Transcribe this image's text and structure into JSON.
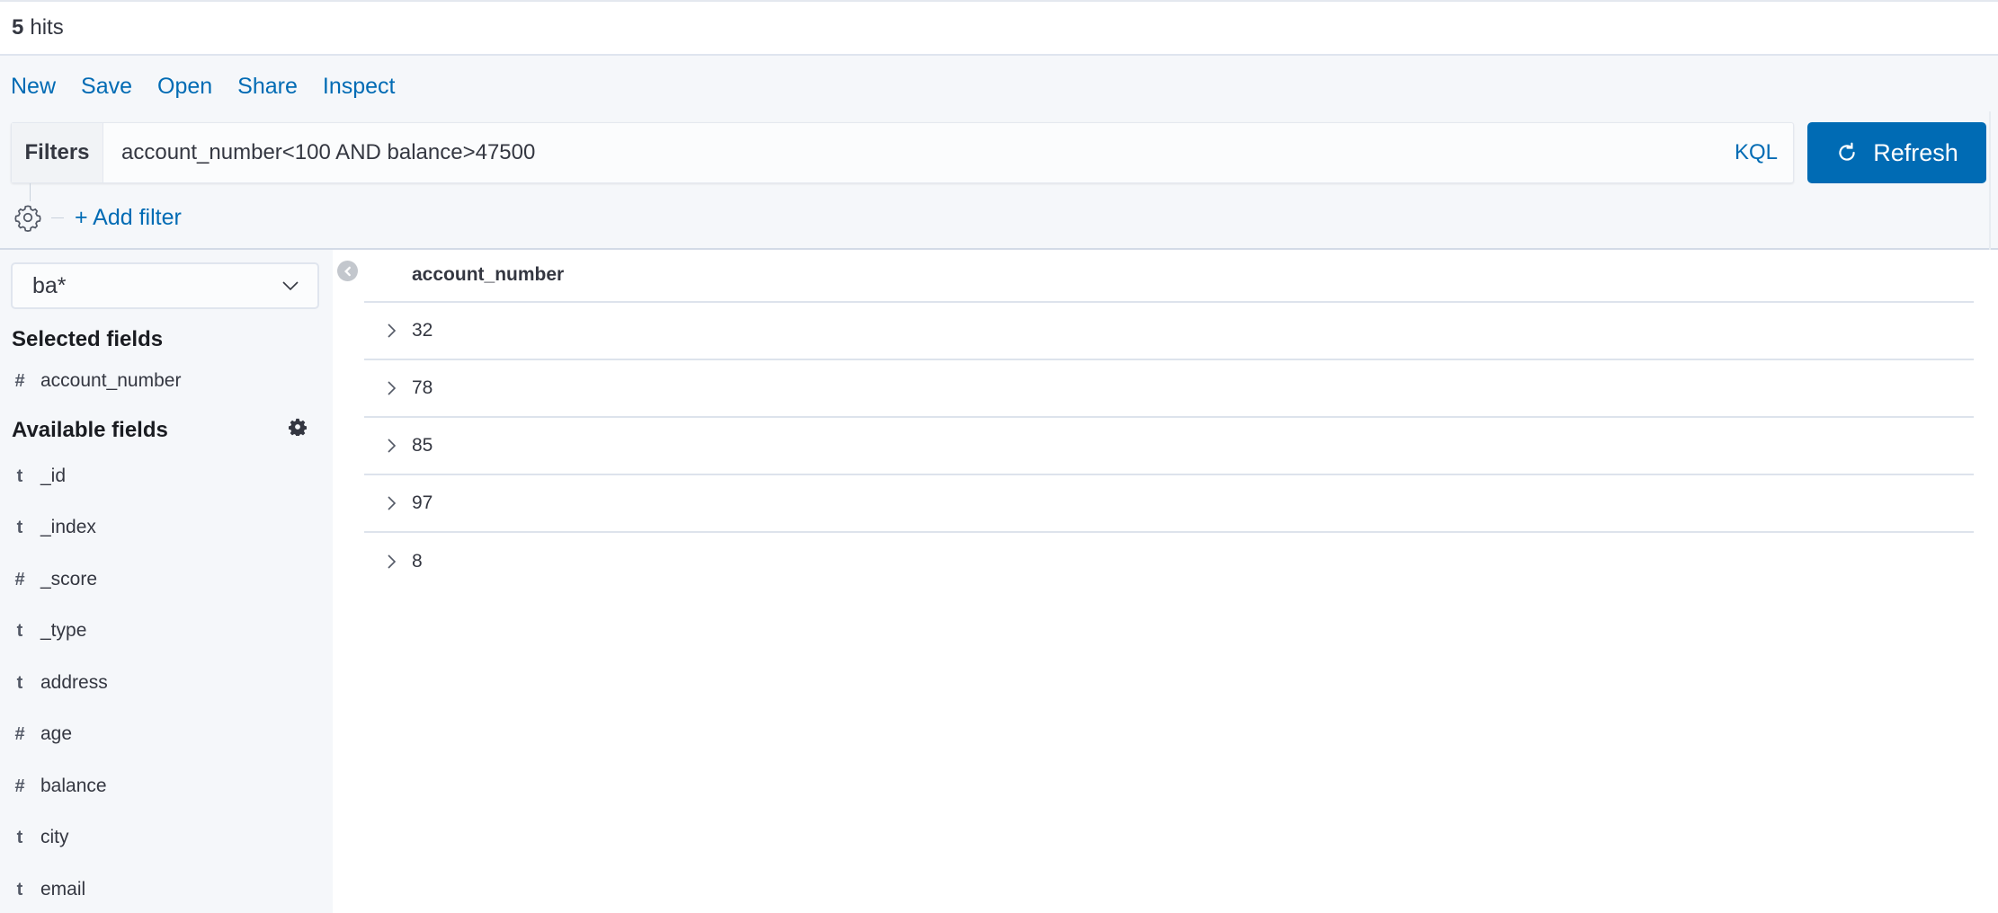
{
  "hits": {
    "count": "5",
    "label": "hits"
  },
  "menu": [
    {
      "label": "New"
    },
    {
      "label": "Save"
    },
    {
      "label": "Open"
    },
    {
      "label": "Share"
    },
    {
      "label": "Inspect"
    }
  ],
  "query": {
    "prepend_label": "Filters",
    "value": "account_number<100 AND balance>47500",
    "language_label": "KQL"
  },
  "refresh_button": {
    "label": "Refresh",
    "icon": "refresh-icon"
  },
  "filters": {
    "settings_icon": "gear-icon",
    "add_filter_label": "+ Add filter"
  },
  "sidebar": {
    "index_pattern": "ba*",
    "selected_title": "Selected fields",
    "selected_fields": [
      {
        "type": "#",
        "name": "account_number"
      }
    ],
    "available_title": "Available fields",
    "available_fields": [
      {
        "type": "t",
        "name": "_id"
      },
      {
        "type": "t",
        "name": "_index"
      },
      {
        "type": "#",
        "name": "_score"
      },
      {
        "type": "t",
        "name": "_type"
      },
      {
        "type": "t",
        "name": "address"
      },
      {
        "type": "#",
        "name": "age"
      },
      {
        "type": "#",
        "name": "balance"
      },
      {
        "type": "t",
        "name": "city"
      },
      {
        "type": "t",
        "name": "email"
      }
    ]
  },
  "table": {
    "columns": [
      "account_number"
    ],
    "rows": [
      {
        "account_number": "32"
      },
      {
        "account_number": "78"
      },
      {
        "account_number": "85"
      },
      {
        "account_number": "97"
      },
      {
        "account_number": "8"
      }
    ]
  },
  "colors": {
    "accent": "#006bb4",
    "panel_bg": "#f5f7fa",
    "text": "#343741"
  }
}
